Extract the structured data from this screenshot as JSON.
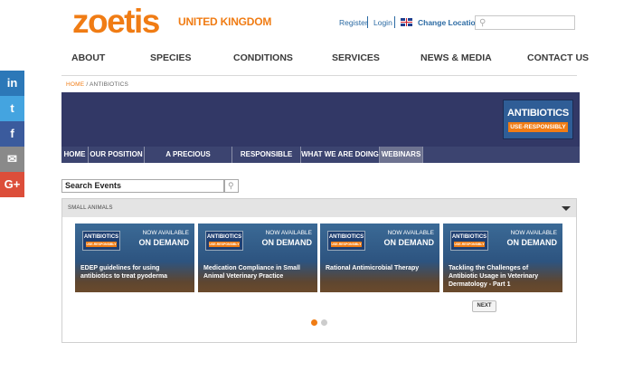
{
  "brand": {
    "logo": "zoetis",
    "region": "UNITED KINGDOM",
    "color": "#f07c14"
  },
  "toplinks": {
    "register": "Register",
    "login": "Login",
    "change_location": "Change Location"
  },
  "nav": [
    "ABOUT",
    "SPECIES",
    "CONDITIONS",
    "SERVICES",
    "NEWS & MEDIA",
    "CONTACT US"
  ],
  "social": [
    {
      "label": "in",
      "icon": "linkedin-icon",
      "color": "#2c78b8"
    },
    {
      "label": "t",
      "icon": "twitter-icon",
      "color": "#44a4e0"
    },
    {
      "label": "f",
      "icon": "facebook-icon",
      "color": "#3b5b9d"
    },
    {
      "label": "✉",
      "icon": "email-icon",
      "color": "#8a8a8a"
    },
    {
      "label": "G+",
      "icon": "google-plus-icon",
      "color": "#dc4e3a"
    }
  ],
  "breadcrumb": {
    "home": "HOME",
    "separator": " / ",
    "current": "ANTIBIOTICS"
  },
  "banner": {
    "badge_line1": "ANTIBIOTICS",
    "badge_line2": "USE-RESPONSIBLY"
  },
  "subnav": [
    {
      "label": "HOME",
      "active": false
    },
    {
      "label": "OUR POSITION",
      "active": false
    },
    {
      "label": "A PRECIOUS RESOURCE",
      "active": false
    },
    {
      "label": "RESPONSIBLE USE",
      "active": false
    },
    {
      "label": "WHAT WE ARE DOING",
      "active": false
    },
    {
      "label": "WEBINARS",
      "active": true
    }
  ],
  "events": {
    "search_label": "Search Events"
  },
  "section": {
    "title": "SMALL ANIMALS"
  },
  "cards": [
    {
      "title": "EDEP guidelines for using antibiotics to treat pyoderma",
      "available": "NOW AVAILABLE",
      "status": "ON DEMAND",
      "badge1": "ANTIBIOTICS",
      "badge2": "USE-RESPONSIBLY"
    },
    {
      "title": "Medication Compliance in Small Animal Veterinary Practice",
      "available": "NOW AVAILABLE",
      "status": "ON DEMAND",
      "badge1": "ANTIBIOTICS",
      "badge2": "USE-RESPONSIBLY"
    },
    {
      "title": "Rational Antimicrobial Therapy",
      "available": "NOW AVAILABLE",
      "status": "ON DEMAND",
      "badge1": "ANTIBIOTICS",
      "badge2": "USE-RESPONSIBLY"
    },
    {
      "title": "Tackling the Challenges of Antibiotic Usage in Veterinary Dermatology - Part 1",
      "available": "NOW AVAILABLE",
      "status": "ON DEMAND",
      "badge1": "ANTIBIOTICS",
      "badge2": "USE-RESPONSIBLY"
    }
  ],
  "pager": {
    "next": "NEXT",
    "pages": 2,
    "current": 1,
    "active_color": "#f07c14",
    "inactive_color": "#cccccc"
  }
}
